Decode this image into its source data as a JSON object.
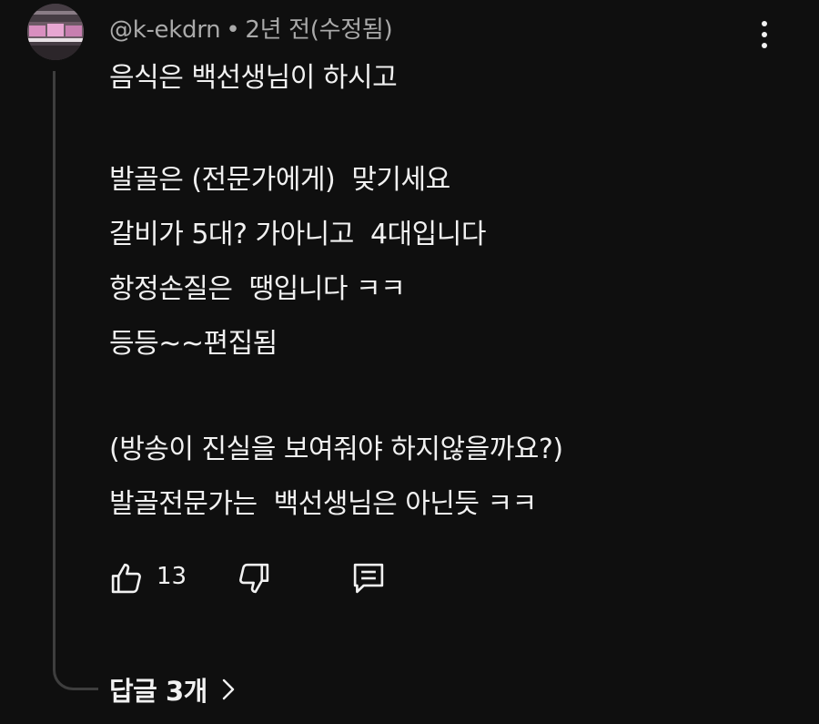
{
  "comment": {
    "author": "@k-ekdrn",
    "separator": "•",
    "time": "2년 전(수정됨)",
    "lines": [
      "음식은 백선생님이 하시고",
      "",
      "발골은 (전문가에게)  맞기세요",
      "갈비가 5대? 가아니고  4대입니다",
      "항정손질은  땡입니다 ㅋㅋ",
      "등등~~편집됨",
      "",
      "(방송이 진실을 보여줘야 하지않을까요?)",
      "발골전문가는  백선생님은 아닌듯 ㅋㅋ"
    ],
    "like_count": "13",
    "replies_label": "답글 3개"
  },
  "icons": {
    "menu": "more-vert-icon",
    "like": "thumb-up-icon",
    "dislike": "thumb-down-icon",
    "reply": "comment-reply-icon",
    "replies": "chevron-right-icon"
  },
  "colors": {
    "background": "#0f0f0f",
    "text": "#f1f1f1",
    "meta": "#aaaaaa",
    "thread_line": "#3e3e3e"
  }
}
